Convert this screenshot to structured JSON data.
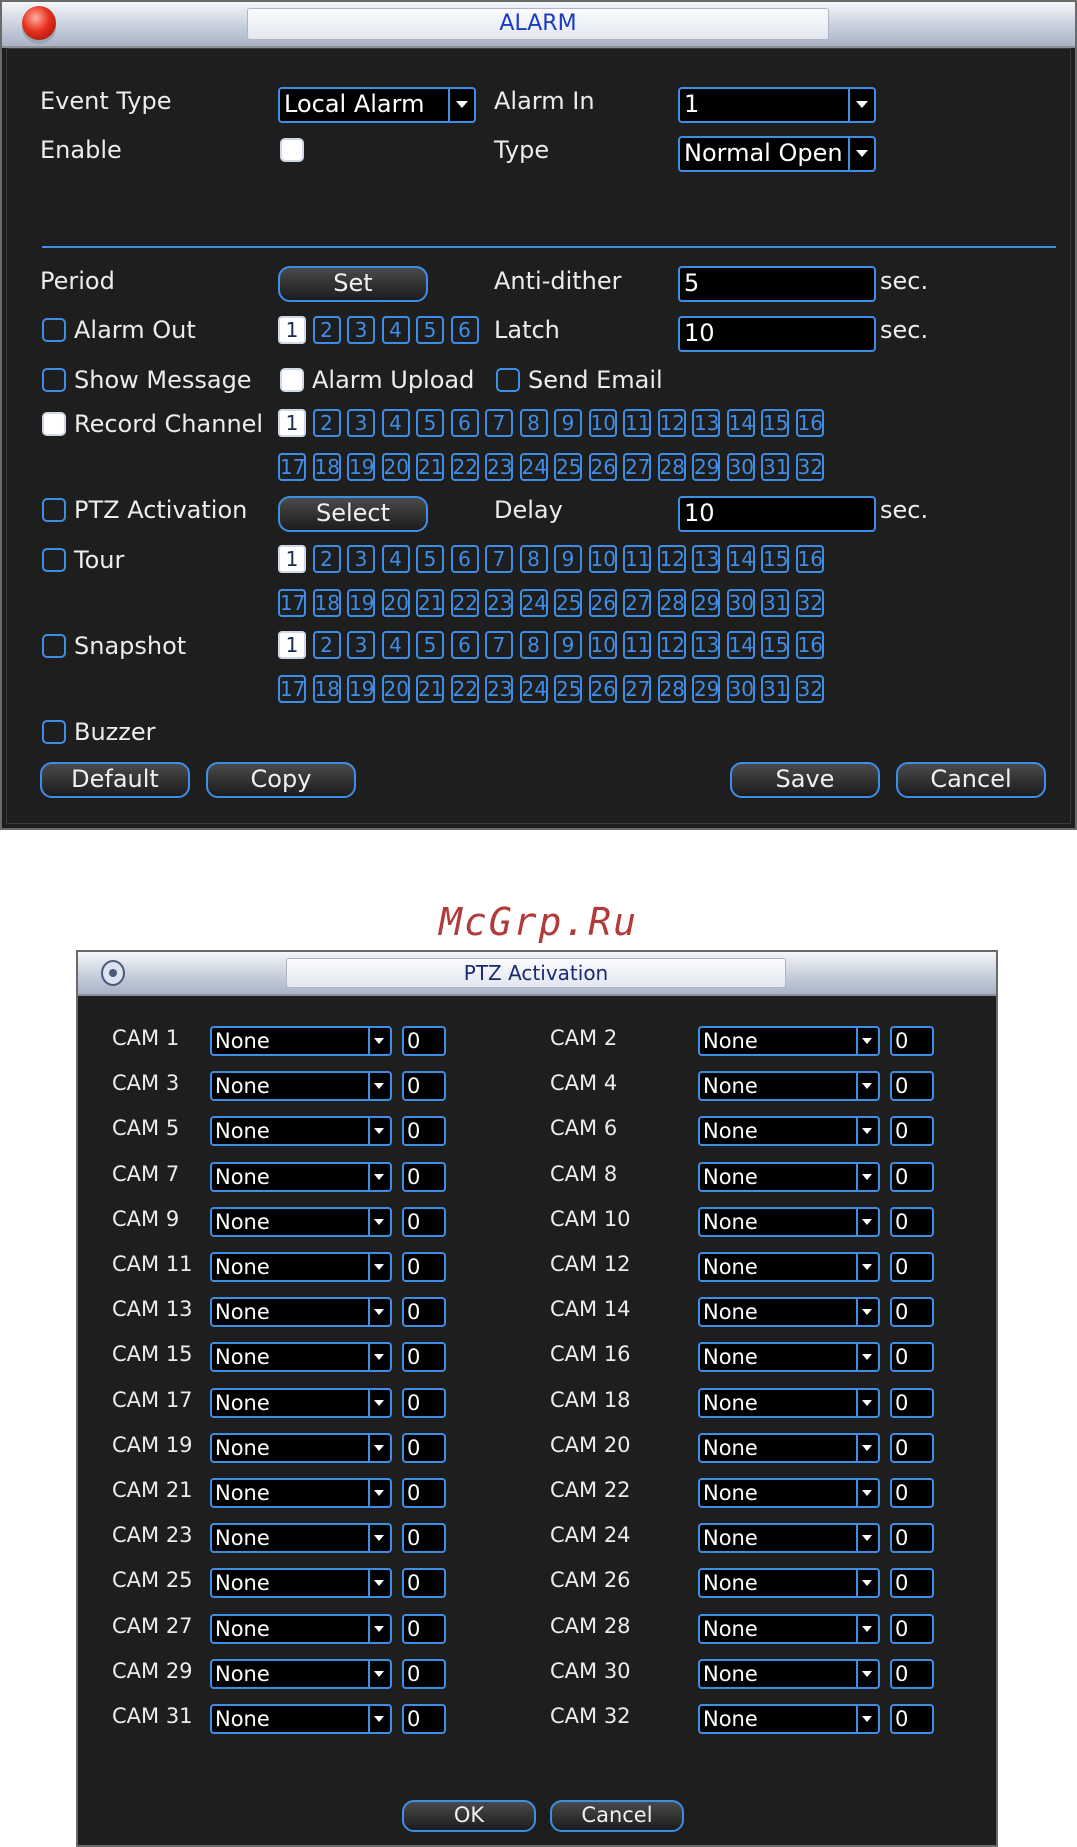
{
  "alarm": {
    "title": "ALARM",
    "event_type_label": "Event Type",
    "event_type_value": "Local Alarm",
    "alarm_in_label": "Alarm In",
    "alarm_in_value": "1",
    "enable_label": "Enable",
    "type_label": "Type",
    "type_value": "Normal Open",
    "period_label": "Period",
    "set_button": "Set",
    "anti_dither_label": "Anti-dither",
    "anti_dither_value": "5",
    "sec": "sec.",
    "alarm_out_label": "Alarm Out",
    "alarm_out_channels": [
      "1",
      "2",
      "3",
      "4",
      "5",
      "6"
    ],
    "latch_label": "Latch",
    "latch_value": "10",
    "show_message_label": "Show Message",
    "alarm_upload_label": "Alarm Upload",
    "send_email_label": "Send Email",
    "record_channel_label": "Record Channel",
    "channels_row1": [
      "1",
      "2",
      "3",
      "4",
      "5",
      "6",
      "7",
      "8",
      "9",
      "10",
      "11",
      "12",
      "13",
      "14",
      "15",
      "16"
    ],
    "channels_row2": [
      "17",
      "18",
      "19",
      "20",
      "21",
      "22",
      "23",
      "24",
      "25",
      "26",
      "27",
      "28",
      "29",
      "30",
      "31",
      "32"
    ],
    "ptz_activation_label": "PTZ Activation",
    "select_button": "Select",
    "delay_label": "Delay",
    "delay_value": "10",
    "tour_label": "Tour",
    "snapshot_label": "Snapshot",
    "buzzer_label": "Buzzer",
    "default_button": "Default",
    "copy_button": "Copy",
    "save_button": "Save",
    "cancel_button": "Cancel"
  },
  "watermark": "McGrp.Ru",
  "ptz": {
    "title": "PTZ Activation",
    "cams": [
      {
        "label": "CAM 1",
        "value": "None",
        "num": "0"
      },
      {
        "label": "CAM 2",
        "value": "None",
        "num": "0"
      },
      {
        "label": "CAM 3",
        "value": "None",
        "num": "0"
      },
      {
        "label": "CAM 4",
        "value": "None",
        "num": "0"
      },
      {
        "label": "CAM 5",
        "value": "None",
        "num": "0"
      },
      {
        "label": "CAM 6",
        "value": "None",
        "num": "0"
      },
      {
        "label": "CAM 7",
        "value": "None",
        "num": "0"
      },
      {
        "label": "CAM 8",
        "value": "None",
        "num": "0"
      },
      {
        "label": "CAM 9",
        "value": "None",
        "num": "0"
      },
      {
        "label": "CAM 10",
        "value": "None",
        "num": "0"
      },
      {
        "label": "CAM 11",
        "value": "None",
        "num": "0"
      },
      {
        "label": "CAM 12",
        "value": "None",
        "num": "0"
      },
      {
        "label": "CAM 13",
        "value": "None",
        "num": "0"
      },
      {
        "label": "CAM 14",
        "value": "None",
        "num": "0"
      },
      {
        "label": "CAM 15",
        "value": "None",
        "num": "0"
      },
      {
        "label": "CAM 16",
        "value": "None",
        "num": "0"
      },
      {
        "label": "CAM 17",
        "value": "None",
        "num": "0"
      },
      {
        "label": "CAM 18",
        "value": "None",
        "num": "0"
      },
      {
        "label": "CAM 19",
        "value": "None",
        "num": "0"
      },
      {
        "label": "CAM 20",
        "value": "None",
        "num": "0"
      },
      {
        "label": "CAM 21",
        "value": "None",
        "num": "0"
      },
      {
        "label": "CAM 22",
        "value": "None",
        "num": "0"
      },
      {
        "label": "CAM 23",
        "value": "None",
        "num": "0"
      },
      {
        "label": "CAM 24",
        "value": "None",
        "num": "0"
      },
      {
        "label": "CAM 25",
        "value": "None",
        "num": "0"
      },
      {
        "label": "CAM 26",
        "value": "None",
        "num": "0"
      },
      {
        "label": "CAM 27",
        "value": "None",
        "num": "0"
      },
      {
        "label": "CAM 28",
        "value": "None",
        "num": "0"
      },
      {
        "label": "CAM 29",
        "value": "None",
        "num": "0"
      },
      {
        "label": "CAM 30",
        "value": "None",
        "num": "0"
      },
      {
        "label": "CAM 31",
        "value": "None",
        "num": "0"
      },
      {
        "label": "CAM 32",
        "value": "None",
        "num": "0"
      }
    ],
    "ok_button": "OK",
    "cancel_button": "Cancel"
  }
}
